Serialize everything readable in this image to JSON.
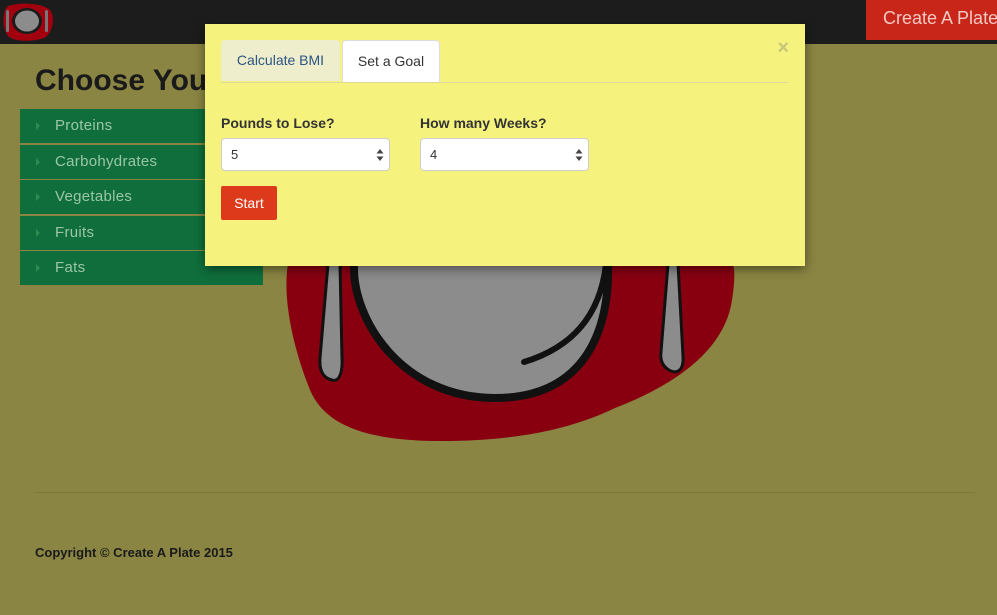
{
  "navbar": {
    "brand_button": "Create A Plate",
    "logo_icon": "plate-logo-icon"
  },
  "page": {
    "heading": "Choose You"
  },
  "menu": {
    "items": [
      {
        "label": "Proteins"
      },
      {
        "label": "Carbohydrates"
      },
      {
        "label": "Vegetables"
      },
      {
        "label": "Fruits"
      },
      {
        "label": "Fats"
      }
    ]
  },
  "modal": {
    "close_symbol": "×",
    "tabs": [
      {
        "label": "Calculate BMI",
        "active": false
      },
      {
        "label": "Set a Goal",
        "active": true
      }
    ],
    "pounds_label": "Pounds to Lose?",
    "pounds_value": "5",
    "weeks_label": "How many Weeks?",
    "weeks_value": "4",
    "start_button": "Start"
  },
  "footer": {
    "copyright": "Copyright © Create A Plate 2015"
  },
  "colors": {
    "page_background": "#8a8542",
    "navbar": "#1c1c1c",
    "brand_button": "#c9261a",
    "menu_item": "#0f6e3c",
    "modal_background": "#f5f27d",
    "start_button": "#dd3a1c",
    "placemat": "#880010"
  }
}
